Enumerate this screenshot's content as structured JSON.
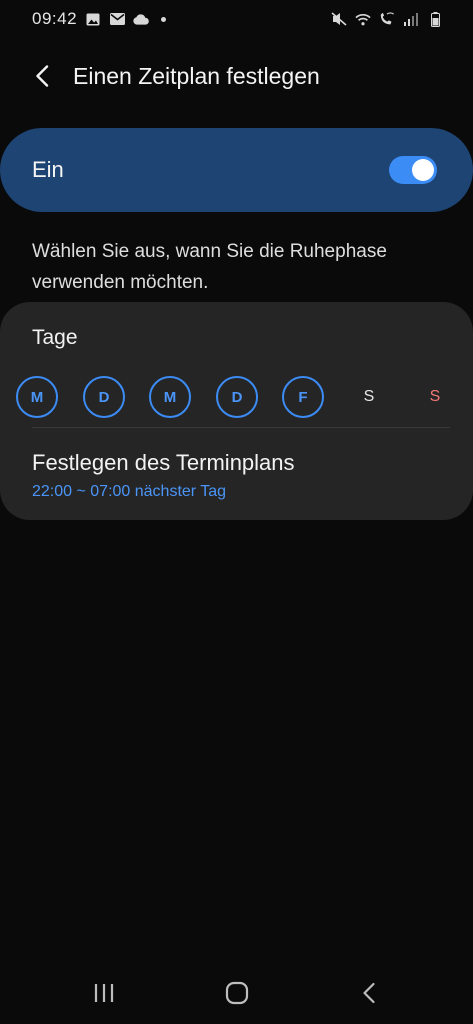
{
  "status_bar": {
    "time": "09:42",
    "left_icons": [
      "gallery-icon",
      "mail-icon",
      "cloud-icon",
      "dot-icon"
    ],
    "right_icons": [
      "mute-vibrate-icon",
      "wifi-icon",
      "wifi-calling-icon",
      "signal-icon",
      "battery-icon"
    ]
  },
  "header": {
    "back_icon": "chevron-left-icon",
    "title": "Einen Zeitplan festlegen"
  },
  "master_switch": {
    "label": "Ein",
    "state": "on"
  },
  "description": "Wählen Sie aus, wann Sie die Ruhephase verwenden möchten.",
  "days_section": {
    "title": "Tage",
    "days": [
      {
        "label": "M",
        "selected": true
      },
      {
        "label": "D",
        "selected": true
      },
      {
        "label": "M",
        "selected": true
      },
      {
        "label": "D",
        "selected": true
      },
      {
        "label": "F",
        "selected": true
      },
      {
        "label": "S",
        "selected": false
      },
      {
        "label": "S",
        "selected": false
      }
    ]
  },
  "schedule": {
    "title": "Festlegen des Terminplans",
    "subtitle": "22:00 ~ 07:00 nächster Tag"
  },
  "nav_bar": {
    "icons": [
      "recent-apps-icon",
      "home-icon",
      "back-icon"
    ]
  },
  "colors": {
    "background": "#0a0a0b",
    "switch_card": "#1d4473",
    "accent": "#3b8cf5",
    "card": "#252526",
    "sunday": "#f07a72"
  }
}
